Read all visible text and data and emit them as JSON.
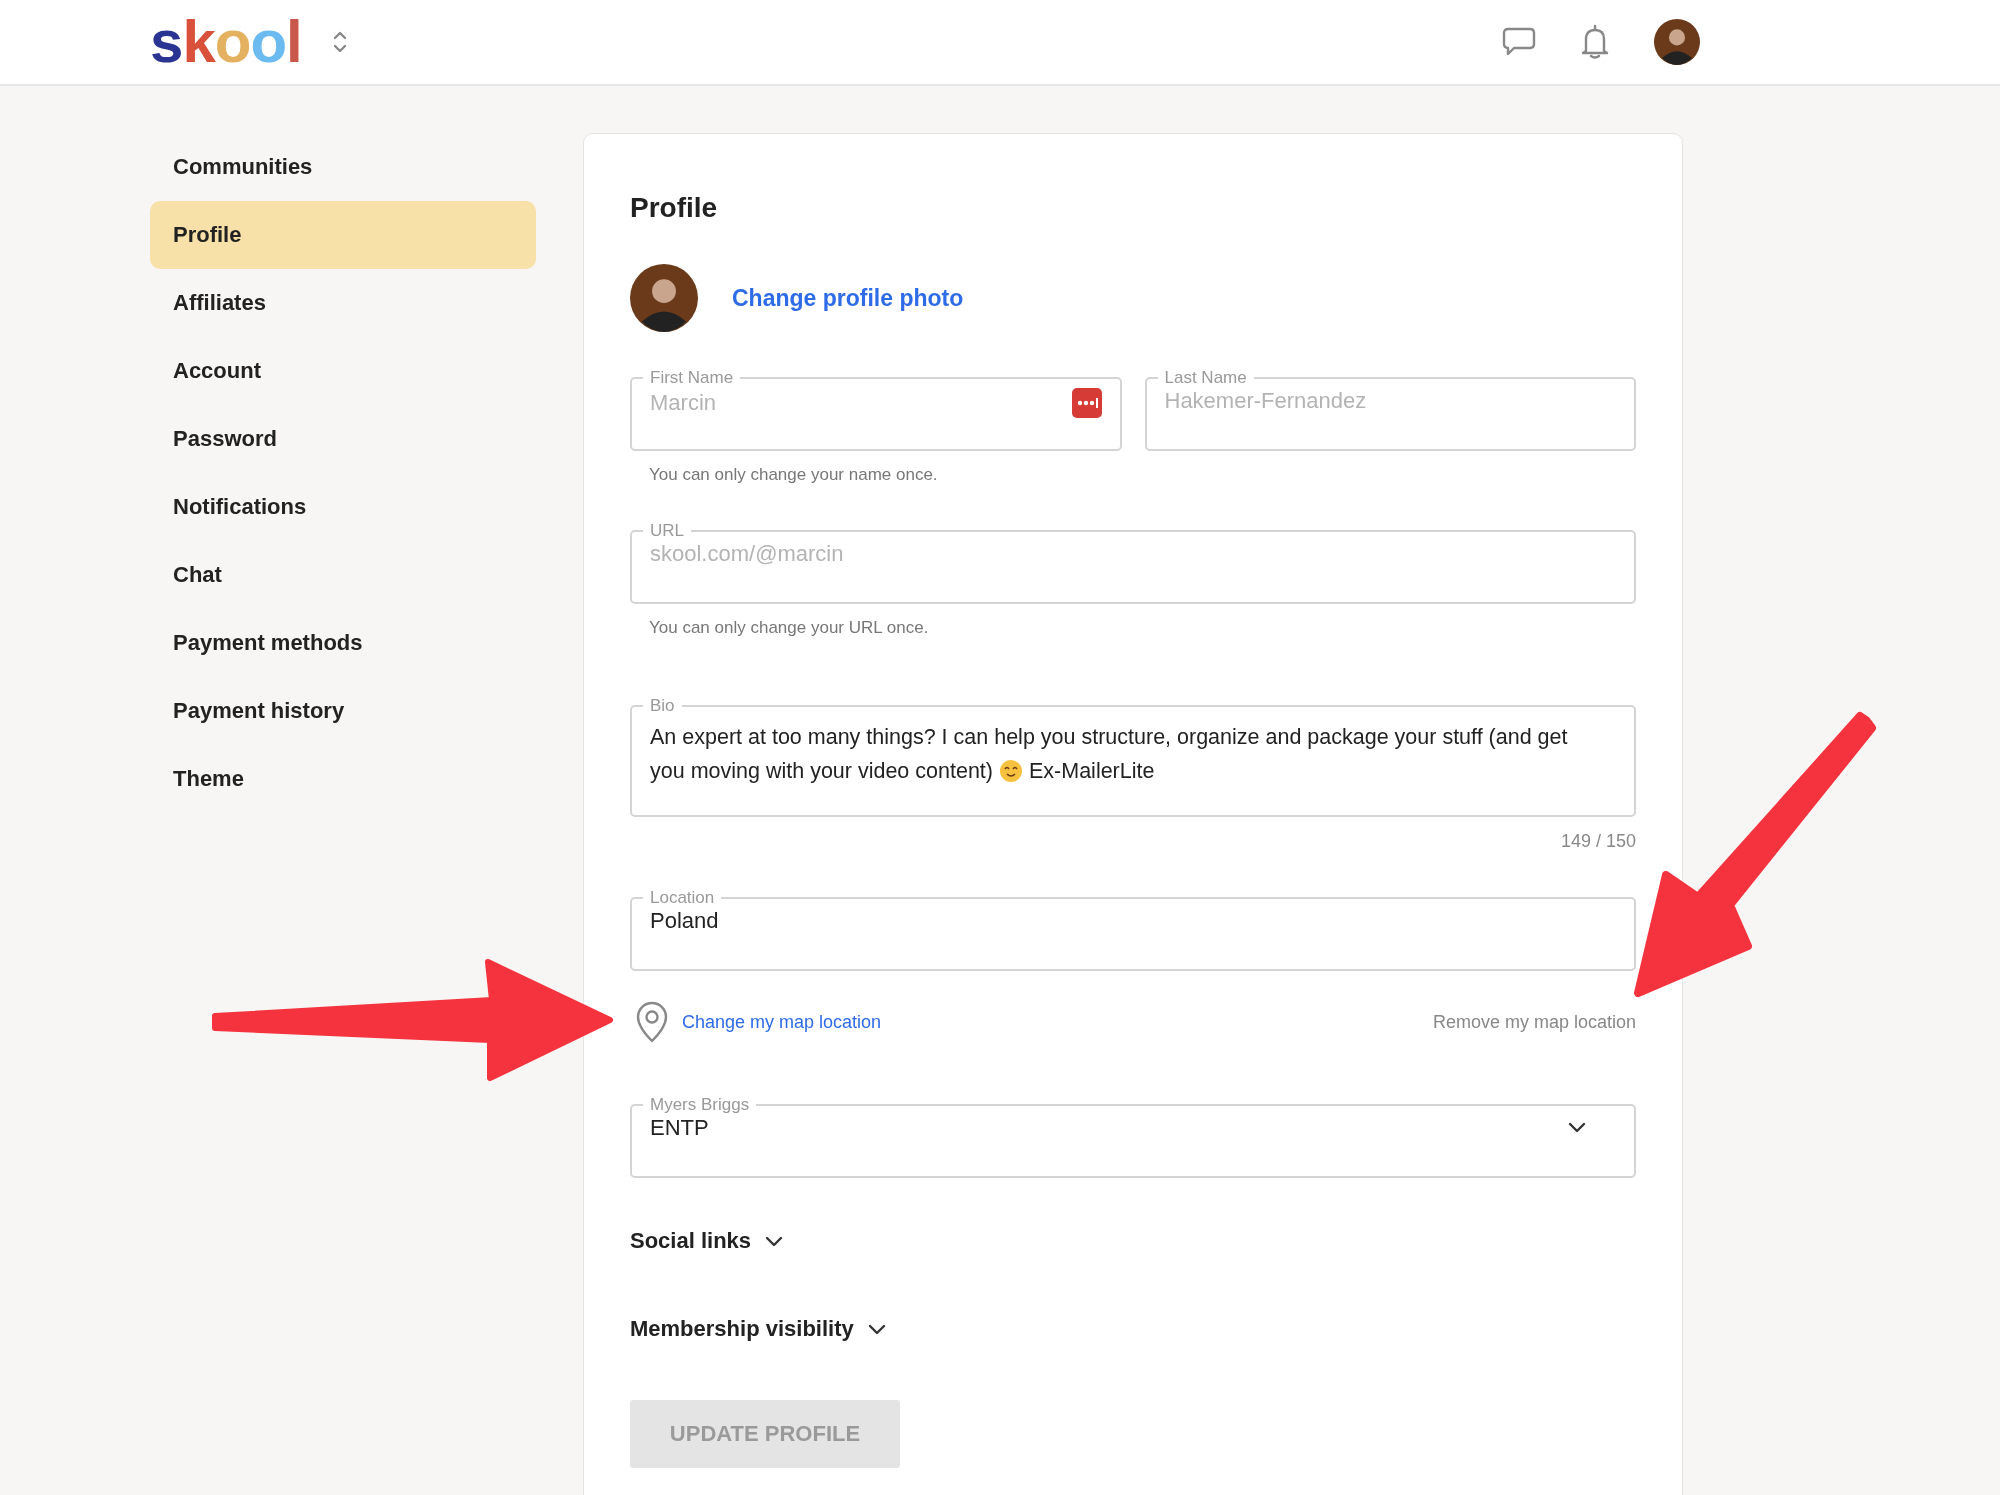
{
  "header": {
    "logo": {
      "letters": [
        {
          "char": "s",
          "color": "#2a3493"
        },
        {
          "char": "k",
          "color": "#d9503b"
        },
        {
          "char": "o",
          "color": "#e3b15f"
        },
        {
          "char": "o",
          "color": "#6bbaf0"
        },
        {
          "char": "l",
          "color": "#c9574a"
        }
      ]
    }
  },
  "sidebar": {
    "items": [
      {
        "label": "Communities",
        "selected": false
      },
      {
        "label": "Profile",
        "selected": true
      },
      {
        "label": "Affiliates",
        "selected": false
      },
      {
        "label": "Account",
        "selected": false
      },
      {
        "label": "Password",
        "selected": false
      },
      {
        "label": "Notifications",
        "selected": false
      },
      {
        "label": "Chat",
        "selected": false
      },
      {
        "label": "Payment methods",
        "selected": false
      },
      {
        "label": "Payment history",
        "selected": false
      },
      {
        "label": "Theme",
        "selected": false
      }
    ]
  },
  "profile": {
    "title": "Profile",
    "change_photo": "Change profile photo",
    "first_name": {
      "label": "First Name",
      "value": "Marcin",
      "disabled": true
    },
    "last_name": {
      "label": "Last Name",
      "value": "Hakemer-Fernandez",
      "disabled": true
    },
    "name_hint": "You can only change your name once.",
    "url": {
      "label": "URL",
      "value": "skool.com/@marcin",
      "disabled": true
    },
    "url_hint": "You can only change your URL once.",
    "bio": {
      "label": "Bio",
      "lines": [
        "An expert at too many things? I can help you structure, organize and package your stuff (and get",
        "you moving with your video content)"
      ],
      "text_after": "Ex-MailerLite",
      "counter": "149 / 150"
    },
    "location": {
      "label": "Location",
      "value": "Poland",
      "disabled": false
    },
    "change_map": "Change my map location",
    "remove_map": "Remove my map location",
    "myers_briggs": {
      "label": "Myers Briggs",
      "value": "ENTP"
    },
    "sections": [
      {
        "label": "Social links",
        "expanded": false
      },
      {
        "label": "Membership visibility",
        "expanded": false
      }
    ],
    "update_button": {
      "label": "UPDATE PROFILE",
      "disabled": true
    }
  }
}
